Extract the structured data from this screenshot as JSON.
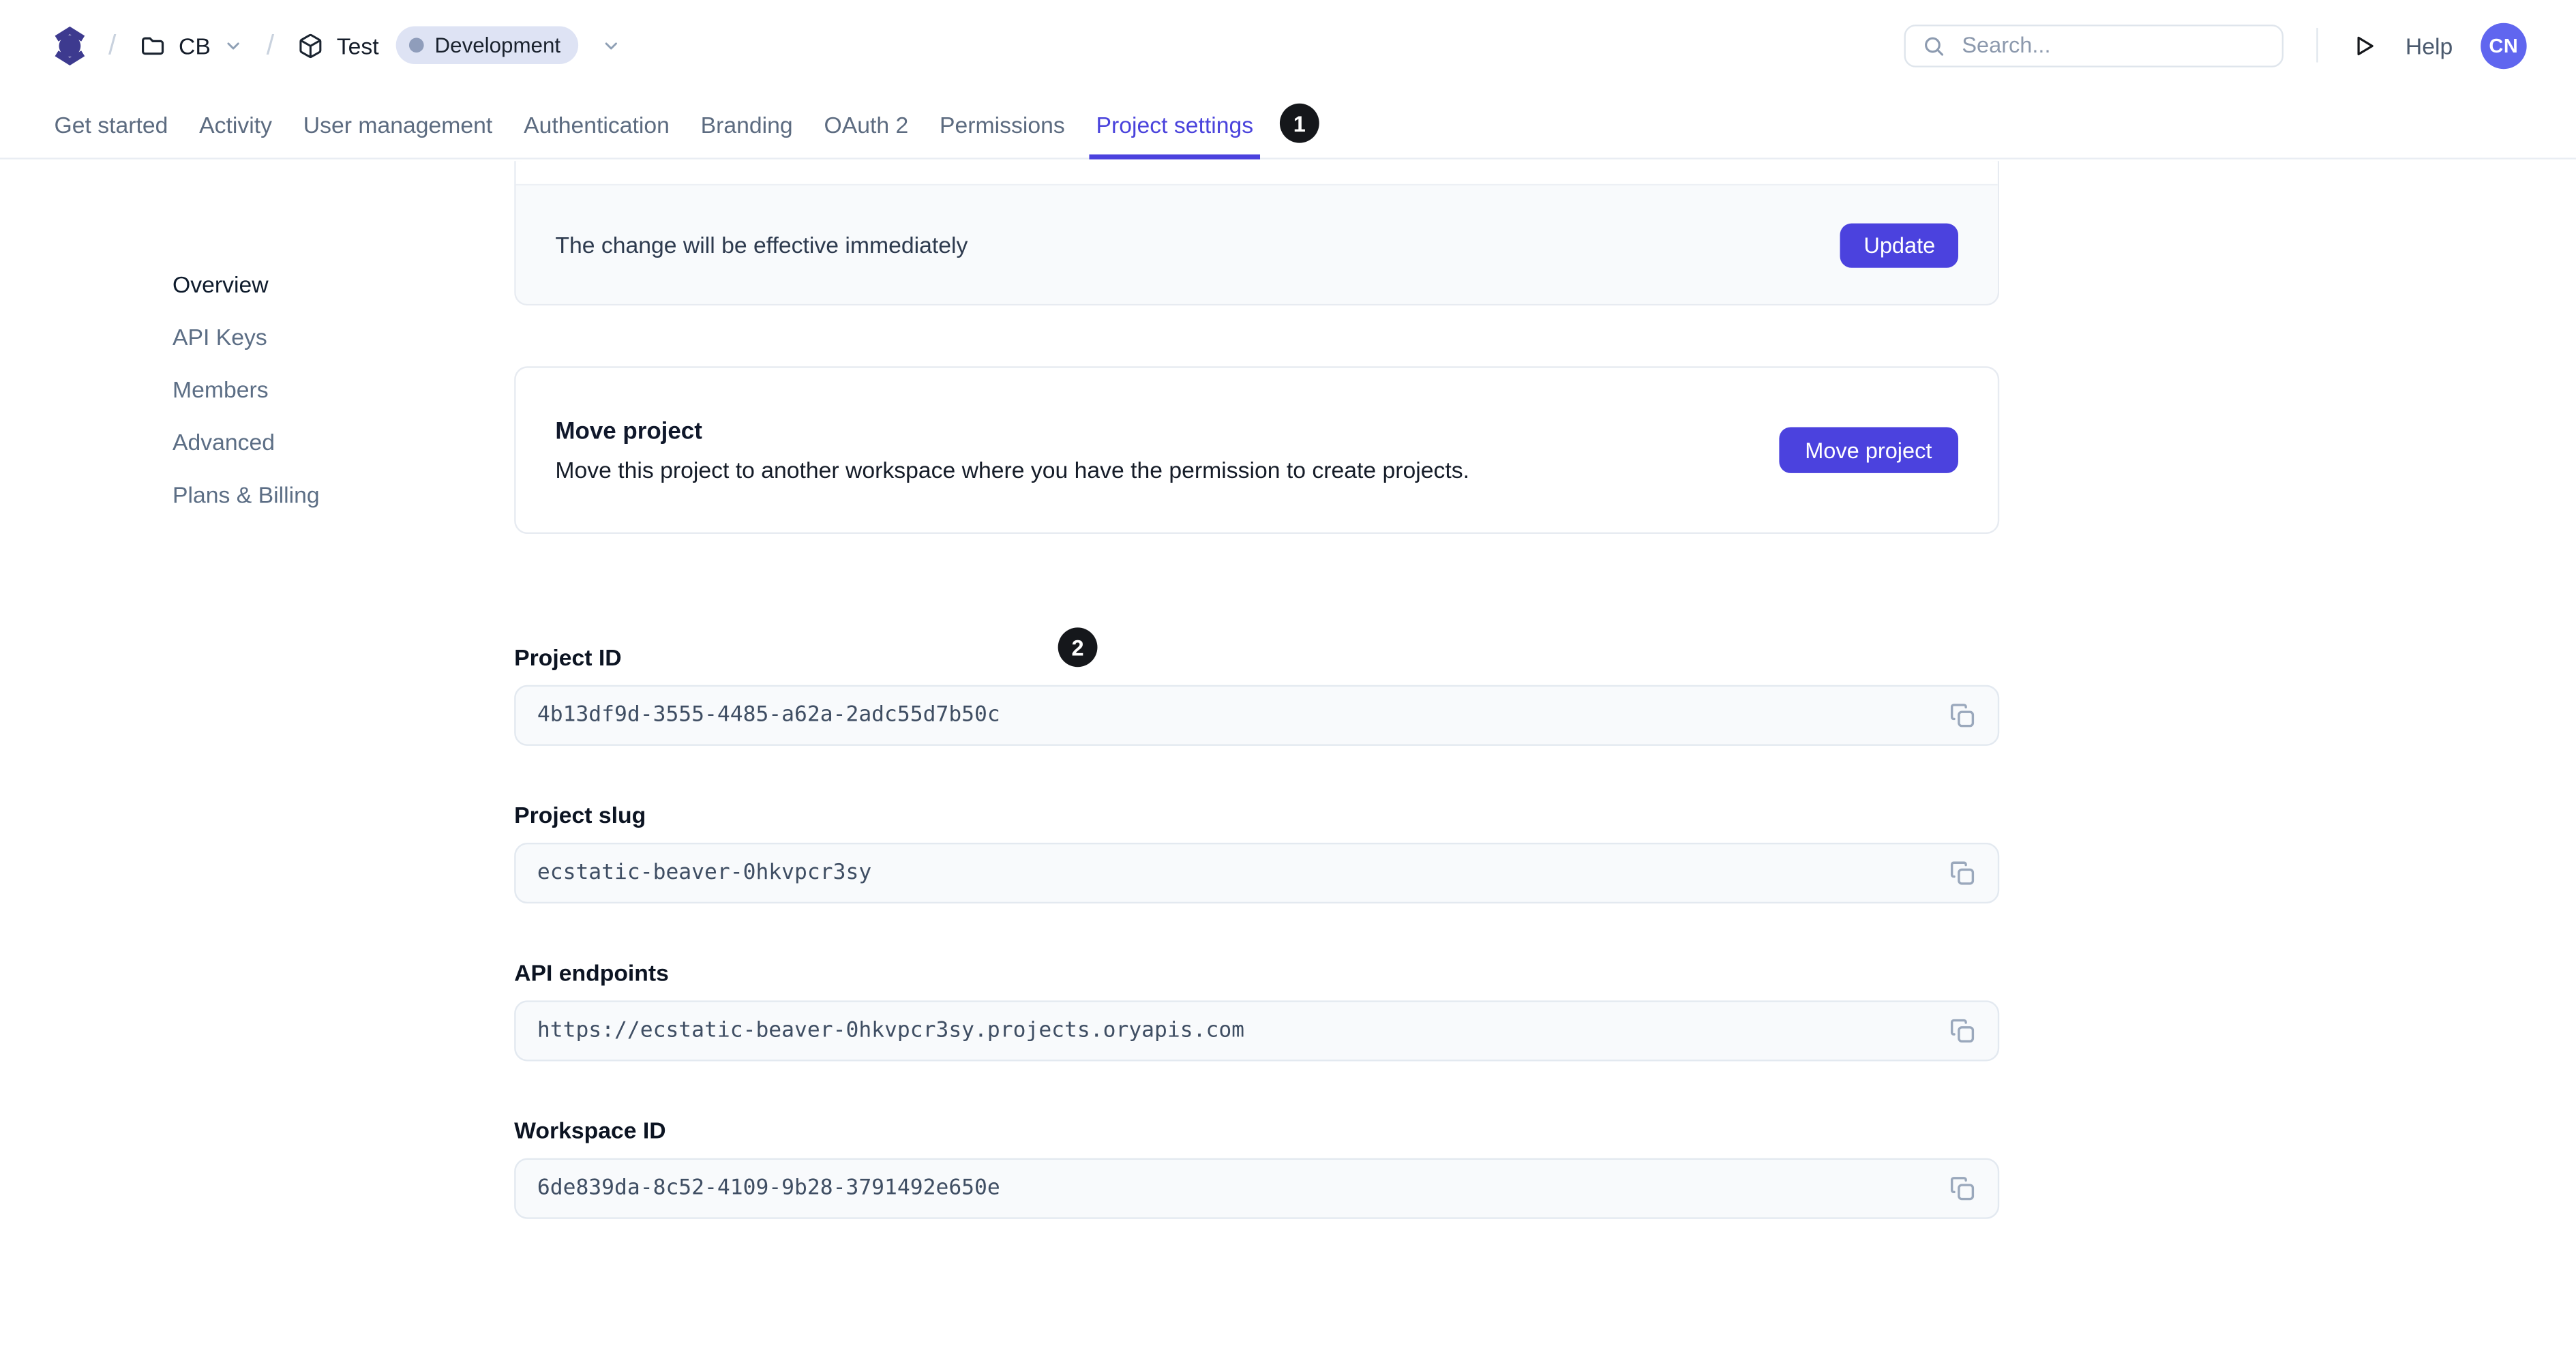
{
  "header": {
    "breadcrumb": {
      "separator": "/",
      "workspace_label": "CB",
      "project_label": "Test",
      "environment_badge": "Development"
    },
    "search_placeholder": "Search...",
    "help_label": "Help",
    "avatar_initials": "CN"
  },
  "tabs": [
    {
      "label": "Get started",
      "active": false
    },
    {
      "label": "Activity",
      "active": false
    },
    {
      "label": "User management",
      "active": false
    },
    {
      "label": "Authentication",
      "active": false
    },
    {
      "label": "Branding",
      "active": false
    },
    {
      "label": "OAuth 2",
      "active": false
    },
    {
      "label": "Permissions",
      "active": false
    },
    {
      "label": "Project settings",
      "active": true
    }
  ],
  "annotations": {
    "tab_badge": "1",
    "section_badge": "2"
  },
  "sidebar": [
    {
      "label": "Overview",
      "active": true
    },
    {
      "label": "API Keys",
      "active": false
    },
    {
      "label": "Members",
      "active": false
    },
    {
      "label": "Advanced",
      "active": false
    },
    {
      "label": "Plans & Billing",
      "active": false
    }
  ],
  "main": {
    "update_card": {
      "note": "The change will be effective immediately",
      "button": "Update"
    },
    "move_card": {
      "title": "Move project",
      "description": "Move this project to another workspace where you have the permission to create projects.",
      "button": "Move project"
    },
    "fields": [
      {
        "label": "Project ID",
        "value": "4b13df9d-3555-4485-a62a-2adc55d7b50c"
      },
      {
        "label": "Project slug",
        "value": "ecstatic-beaver-0hkvpcr3sy"
      },
      {
        "label": "API endpoints",
        "value": "https://ecstatic-beaver-0hkvpcr3sy.projects.oryapis.com"
      },
      {
        "label": "Workspace ID",
        "value": "6de839da-8c52-4109-9b28-3791492e650e"
      }
    ]
  },
  "icons": {
    "logo": "ory-logo (circle with chevrons)",
    "folder": "folder outline",
    "package": "package box outline",
    "chevron": "chevron-down",
    "search": "magnifier",
    "play": "triangle outline",
    "copy": "two overlapping rounded squares"
  },
  "colors": {
    "accent": "#4b42de",
    "logo": "#3d3a8f",
    "avatar_bg": "#6066ef",
    "env_badge_bg": "#dee3f4",
    "env_badge_dot": "#8f9dbb",
    "annotation_bg": "#15171b",
    "field_bg": "#f8fafc",
    "border": "#e7ebf1"
  }
}
